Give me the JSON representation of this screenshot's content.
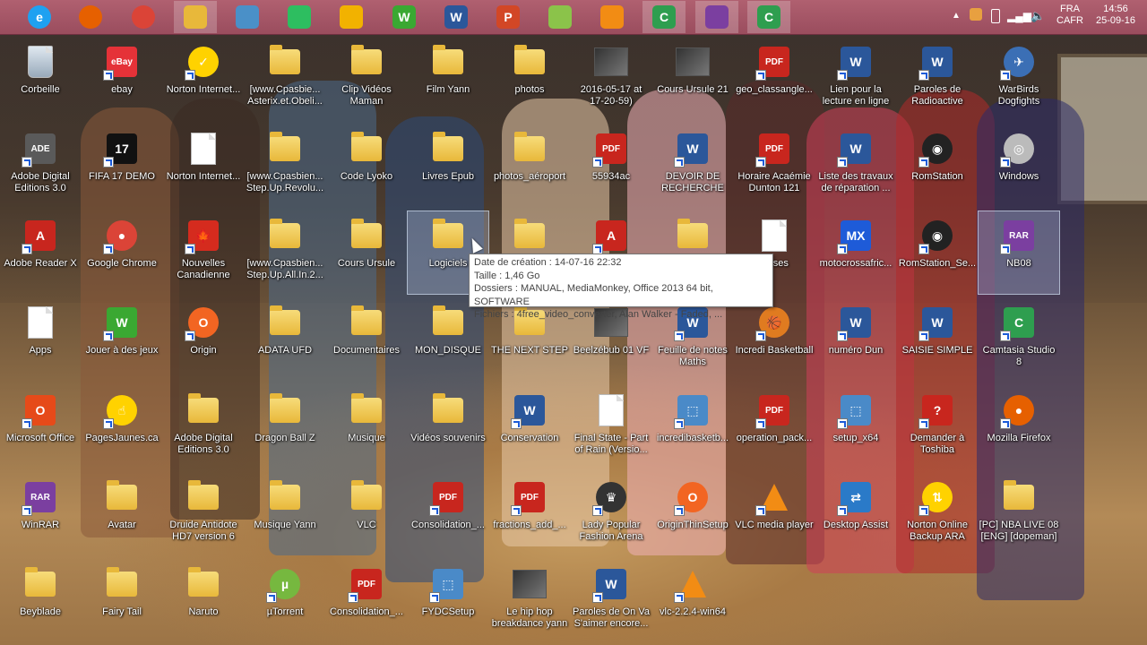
{
  "taskbar": {
    "icons": [
      {
        "name": "internet-explorer-icon",
        "glyph": "e",
        "color": "#1ea1f1"
      },
      {
        "name": "firefox-icon",
        "glyph": "",
        "color": "#e66000"
      },
      {
        "name": "chrome-icon",
        "glyph": "",
        "color": "#db4437"
      },
      {
        "name": "file-explorer-icon",
        "glyph": "",
        "color": "#e8b83a"
      },
      {
        "name": "control-panel-icon",
        "glyph": "",
        "color": "#4a90c8"
      },
      {
        "name": "evernote-icon",
        "glyph": "",
        "color": "#2dbe60"
      },
      {
        "name": "speedometer-icon",
        "glyph": "",
        "color": "#f2b200"
      },
      {
        "name": "games-icon",
        "glyph": "W",
        "color": "#3aa832"
      },
      {
        "name": "word-icon",
        "glyph": "W",
        "color": "#2b579a"
      },
      {
        "name": "powerpoint-icon",
        "glyph": "P",
        "color": "#d24726"
      },
      {
        "name": "lab-flask-icon",
        "glyph": "",
        "color": "#8bc34a"
      },
      {
        "name": "vlc-icon",
        "glyph": "",
        "color": "#f28c14"
      },
      {
        "name": "camtasia-icon",
        "glyph": "C",
        "color": "#2e9e4f"
      },
      {
        "name": "winrar-icon",
        "glyph": "",
        "color": "#7b3fa0"
      },
      {
        "name": "camtasia-recorder-icon",
        "glyph": "C",
        "color": "#2e9e4f"
      }
    ],
    "tray": {
      "lang_top": "FRA",
      "lang_bottom": "CAFR",
      "time": "14:56",
      "date": "25-09-16"
    }
  },
  "desktop_icons": [
    {
      "label": "Corbeille",
      "type": "recycle",
      "color": "#9ab"
    },
    {
      "label": "ebay",
      "type": "badge",
      "glyph": "eBay",
      "color": "#e53238"
    },
    {
      "label": "Norton Internet...",
      "type": "round",
      "glyph": "✓",
      "color": "#ffd200"
    },
    {
      "label": "[www.Cpasbie...\nAsterix.et.Obeli...",
      "type": "folder"
    },
    {
      "label": "Clip Vidéos\nMaman",
      "type": "folder"
    },
    {
      "label": "Film Yann",
      "type": "folder"
    },
    {
      "label": "photos",
      "type": "folder"
    },
    {
      "label": "2016-05-17 at\n17-20-59)",
      "type": "thumb"
    },
    {
      "label": "Cours Ursule 21",
      "type": "thumb"
    },
    {
      "label": "geo_classangle...",
      "type": "badge",
      "glyph": "PDF",
      "color": "#c8261e"
    },
    {
      "label": "Lien pour la\nlecture en ligne",
      "type": "badge",
      "glyph": "W",
      "color": "#2b579a"
    },
    {
      "label": "Paroles de\nRadioactive",
      "type": "badge",
      "glyph": "W",
      "color": "#2b579a"
    },
    {
      "label": "WarBirds\nDogfights",
      "type": "round",
      "glyph": "✈",
      "color": "#3b6fb5"
    },
    {
      "label": "Adobe Digital\nEditions 3.0",
      "type": "badge",
      "glyph": "ADE",
      "color": "#5a5a5a"
    },
    {
      "label": "FIFA 17 DEMO",
      "type": "badge",
      "glyph": "17",
      "color": "#111"
    },
    {
      "label": "Norton Internet...",
      "type": "paper"
    },
    {
      "label": "[www.Cpasbien...\nStep.Up.Revolu...",
      "type": "folder"
    },
    {
      "label": "Code Lyoko",
      "type": "folder"
    },
    {
      "label": "Livres Epub",
      "type": "folder"
    },
    {
      "label": "photos_aéroport",
      "type": "folder"
    },
    {
      "label": "55934ac",
      "type": "badge",
      "glyph": "PDF",
      "color": "#c8261e"
    },
    {
      "label": "DEVOIR DE\nRECHERCHE",
      "type": "badge",
      "glyph": "W",
      "color": "#2b579a"
    },
    {
      "label": "Horaire Acaémie\nDunton 121",
      "type": "badge",
      "glyph": "PDF",
      "color": "#c8261e"
    },
    {
      "label": "Liste des travaux\nde réparation ...",
      "type": "badge",
      "glyph": "W",
      "color": "#2b579a"
    },
    {
      "label": "RomStation",
      "type": "round",
      "glyph": "◉",
      "color": "#222"
    },
    {
      "label": "Windows",
      "type": "round",
      "glyph": "◎",
      "color": "#bbb"
    },
    {
      "label": "Adobe Reader X",
      "type": "badge",
      "glyph": "A",
      "color": "#c8261e"
    },
    {
      "label": "Google Chrome",
      "type": "round",
      "glyph": "●",
      "color": "#db4437"
    },
    {
      "label": "Nouvelles\nCanadienne",
      "type": "badge",
      "glyph": "🍁",
      "color": "#d52b1e"
    },
    {
      "label": "[www.Cpasbien...\nStep.Up.All.In.2...",
      "type": "folder"
    },
    {
      "label": "Cours Ursule",
      "type": "folder"
    },
    {
      "label": "Logiciels",
      "type": "folder"
    },
    {
      "label": "",
      "type": "folder"
    },
    {
      "label": "",
      "type": "badge",
      "glyph": "A",
      "color": "#c8261e"
    },
    {
      "label": "",
      "type": "folder"
    },
    {
      "label": "tesses",
      "type": "paper"
    },
    {
      "label": "motocrossafric...",
      "type": "badge",
      "glyph": "MX",
      "color": "#1e5bd8"
    },
    {
      "label": "RomStation_Se...",
      "type": "round",
      "glyph": "◉",
      "color": "#222"
    },
    {
      "label": "NB08",
      "type": "badge",
      "glyph": "RAR",
      "color": "#7b3fa0"
    },
    {
      "label": "Apps",
      "type": "paper"
    },
    {
      "label": "Jouer à des jeux",
      "type": "badge",
      "glyph": "W",
      "color": "#3aa832"
    },
    {
      "label": "Origin",
      "type": "round",
      "glyph": "O",
      "color": "#f26522"
    },
    {
      "label": "ADATA UFD",
      "type": "folder"
    },
    {
      "label": "Documentaires",
      "type": "folder"
    },
    {
      "label": "MON_DISQUE",
      "type": "folder"
    },
    {
      "label": "THE NEXT STEP",
      "type": "folder"
    },
    {
      "label": "Beelzébub 01 VF",
      "type": "thumb"
    },
    {
      "label": "Feuille de notes\nMaths",
      "type": "badge",
      "glyph": "W",
      "color": "#2b579a"
    },
    {
      "label": "Incredi Basketball",
      "type": "round",
      "glyph": "🏀",
      "color": "#e07b20"
    },
    {
      "label": "numéro Dun",
      "type": "badge",
      "glyph": "W",
      "color": "#2b579a"
    },
    {
      "label": "SAISIE SIMPLE",
      "type": "badge",
      "glyph": "W",
      "color": "#2b579a"
    },
    {
      "label": "Camtasia Studio\n8",
      "type": "badge",
      "glyph": "C",
      "color": "#2e9e4f"
    },
    {
      "label": "Microsoft Office",
      "type": "badge",
      "glyph": "O",
      "color": "#e64a19"
    },
    {
      "label": "PagesJaunes.ca",
      "type": "round",
      "glyph": "☝",
      "color": "#ffd200"
    },
    {
      "label": "Adobe Digital\nEditions 3.0",
      "type": "folder"
    },
    {
      "label": "Dragon Ball Z",
      "type": "folder"
    },
    {
      "label": "Musique",
      "type": "folder"
    },
    {
      "label": "Vidéos souvenirs",
      "type": "folder"
    },
    {
      "label": "Conservation",
      "type": "badge",
      "glyph": "W",
      "color": "#2b579a"
    },
    {
      "label": "Final State - Part\nof Rain (Versio...",
      "type": "paper"
    },
    {
      "label": "incredibasketb...",
      "type": "badge",
      "glyph": "⬚",
      "color": "#4a8ac8"
    },
    {
      "label": "operation_pack...",
      "type": "badge",
      "glyph": "PDF",
      "color": "#c8261e"
    },
    {
      "label": "setup_x64",
      "type": "badge",
      "glyph": "⬚",
      "color": "#4a8ac8"
    },
    {
      "label": "Demander à\nToshiba",
      "type": "badge",
      "glyph": "?",
      "color": "#c8261e"
    },
    {
      "label": "Mozilla Firefox",
      "type": "round",
      "glyph": "●",
      "color": "#e66000"
    },
    {
      "label": "WinRAR",
      "type": "badge",
      "glyph": "RAR",
      "color": "#7b3fa0"
    },
    {
      "label": "Avatar",
      "type": "folder"
    },
    {
      "label": "Druide Antidote\nHD7 version 6",
      "type": "folder"
    },
    {
      "label": "Musique Yann",
      "type": "folder"
    },
    {
      "label": "VLC",
      "type": "folder"
    },
    {
      "label": "Consolidation_...",
      "type": "badge",
      "glyph": "PDF",
      "color": "#c8261e"
    },
    {
      "label": "fractions_add_...",
      "type": "badge",
      "glyph": "PDF",
      "color": "#c8261e"
    },
    {
      "label": "Lady Popular\nFashion Arena",
      "type": "round",
      "glyph": "♛",
      "color": "#333"
    },
    {
      "label": "OriginThinSetup",
      "type": "round",
      "glyph": "O",
      "color": "#f26522"
    },
    {
      "label": "VLC media player",
      "type": "cone"
    },
    {
      "label": "Desktop Assist",
      "type": "badge",
      "glyph": "⇄",
      "color": "#2a7ac8"
    },
    {
      "label": "Norton Online\nBackup ARA",
      "type": "round",
      "glyph": "⇅",
      "color": "#ffd200"
    },
    {
      "label": "[PC] NBA LIVE 08\n[ENG] [dopeman]",
      "type": "folder"
    },
    {
      "label": "Beyblade",
      "type": "folder"
    },
    {
      "label": "Fairy Tail",
      "type": "folder"
    },
    {
      "label": "Naruto",
      "type": "folder"
    },
    {
      "label": "µTorrent",
      "type": "round",
      "glyph": "µ",
      "color": "#76b83f"
    },
    {
      "label": "Consolidation_...",
      "type": "badge",
      "glyph": "PDF",
      "color": "#c8261e"
    },
    {
      "label": "FYDCSetup",
      "type": "badge",
      "glyph": "⬚",
      "color": "#4a8ac8"
    },
    {
      "label": "Le hip hop\nbreakdance yann",
      "type": "thumb"
    },
    {
      "label": "Paroles de On Va\nS'aimer encore...",
      "type": "badge",
      "glyph": "W",
      "color": "#2b579a"
    },
    {
      "label": "vlc-2.2.4-win64",
      "type": "cone"
    }
  ],
  "tooltip": {
    "line1": "Date de création : 14-07-16 22:32",
    "line2": "Taille : 1,46 Go",
    "line3": "Dossiers : MANUAL, MediaMonkey, Office 2013 64 bit, SOFTWARE",
    "line4": "Fichiers : 4free_video_converter, Alan Walker - Faded, ..."
  }
}
